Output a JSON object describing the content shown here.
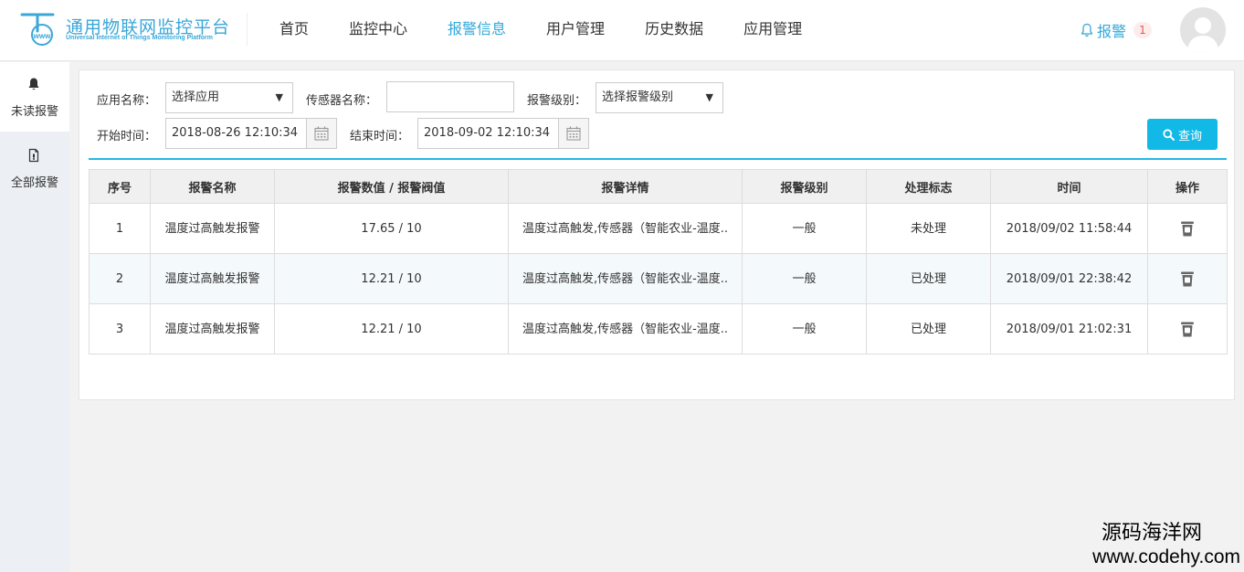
{
  "header": {
    "logo_title": "通用物联网监控平台",
    "logo_subtitle": "Universal Internet of Things Monitoring Platform",
    "logo_mark_text": "www",
    "nav": [
      {
        "label": "首页",
        "active": false
      },
      {
        "label": "监控中心",
        "active": false
      },
      {
        "label": "报警信息",
        "active": true
      },
      {
        "label": "用户管理",
        "active": false
      },
      {
        "label": "历史数据",
        "active": false
      },
      {
        "label": "应用管理",
        "active": false
      }
    ],
    "alarm_label": "报警",
    "alarm_count": "1",
    "accent_color": "#33a8d8"
  },
  "sidebar": {
    "items": [
      {
        "label": "未读报警",
        "icon": "bell-icon",
        "active": true
      },
      {
        "label": "全部报警",
        "icon": "document-icon",
        "active": false
      }
    ]
  },
  "filters": {
    "app_label": "应用名称：",
    "app_selected": "选择应用",
    "sensor_label": "传感器名称：",
    "sensor_value": "",
    "level_label": "报警级别：",
    "level_selected": "选择报警级别",
    "start_label": "开始时间：",
    "start_value": "2018-08-26 12:10:34",
    "end_label": "结束时间：",
    "end_value": "2018-09-02 12:10:34",
    "query_label": "查询",
    "query_color": "#13b9e6"
  },
  "table": {
    "columns": [
      "序号",
      "报警名称",
      "报警数值 / 报警阀值",
      "报警详情",
      "报警级别",
      "处理标志",
      "时间",
      "操作"
    ],
    "rows": [
      {
        "index": "1",
        "name": "温度过高触发报警",
        "value": "17.65 / 10",
        "detail": "温度过高触发,传感器（智能农业-温度..",
        "level": "一般",
        "status": "未处理",
        "status_handled": false,
        "time": "2018/09/02 11:58:44"
      },
      {
        "index": "2",
        "name": "温度过高触发报警",
        "value": "12.21 / 10",
        "detail": "温度过高触发,传感器（智能农业-温度..",
        "level": "一般",
        "status": "已处理",
        "status_handled": true,
        "time": "2018/09/01 22:38:42"
      },
      {
        "index": "3",
        "name": "温度过高触发报警",
        "value": "12.21 / 10",
        "detail": "温度过高触发,传感器（智能农业-温度..",
        "level": "一般",
        "status": "已处理",
        "status_handled": true,
        "time": "2018/09/01 21:02:31"
      }
    ],
    "status_colors": {
      "unhandled": "#d9302c",
      "handled": "#aaaaaa"
    }
  },
  "watermark": {
    "line1": "源码海洋网",
    "line2": "www.codehy.com"
  }
}
